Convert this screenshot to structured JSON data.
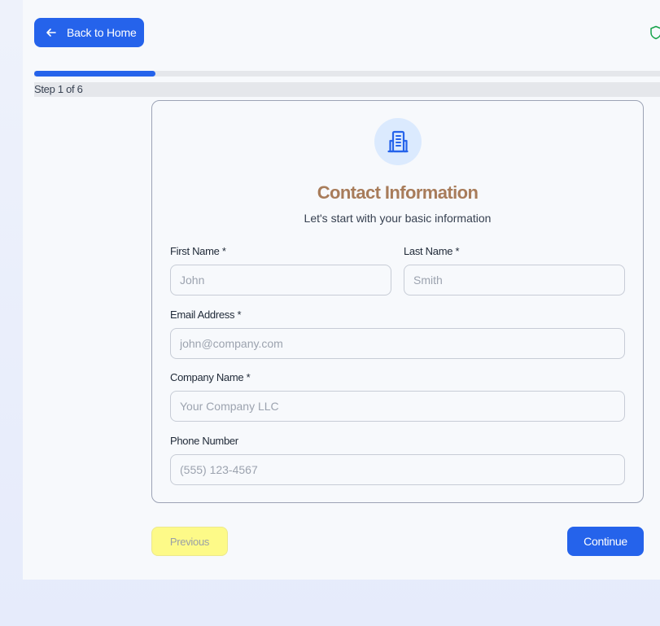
{
  "header": {
    "back_label": "Back to Home",
    "back_icon": "arrow-left-icon",
    "security_icon": "shield-icon"
  },
  "progress": {
    "current_step": 1,
    "total_steps": 6,
    "fraction": 0.1667,
    "step_text": "Step 1 of 6"
  },
  "card": {
    "icon": "building-icon",
    "title": "Contact Information",
    "subtitle": "Let's start with your basic information"
  },
  "form": {
    "first_name": {
      "label": "First Name *",
      "value": "",
      "placeholder": "John"
    },
    "last_name": {
      "label": "Last Name *",
      "value": "",
      "placeholder": "Smith"
    },
    "email": {
      "label": "Email Address *",
      "value": "",
      "placeholder": "john@company.com"
    },
    "company": {
      "label": "Company Name *",
      "value": "",
      "placeholder": "Your Company LLC"
    },
    "phone": {
      "label": "Phone Number",
      "value": "",
      "placeholder": "(555) 123-4567"
    }
  },
  "nav": {
    "previous_label": "Previous",
    "continue_label": "Continue"
  },
  "colors": {
    "accent": "#2563eb",
    "title": "#a87c5a",
    "previous_bg": "#fdfa88",
    "security": "#16a34a"
  }
}
